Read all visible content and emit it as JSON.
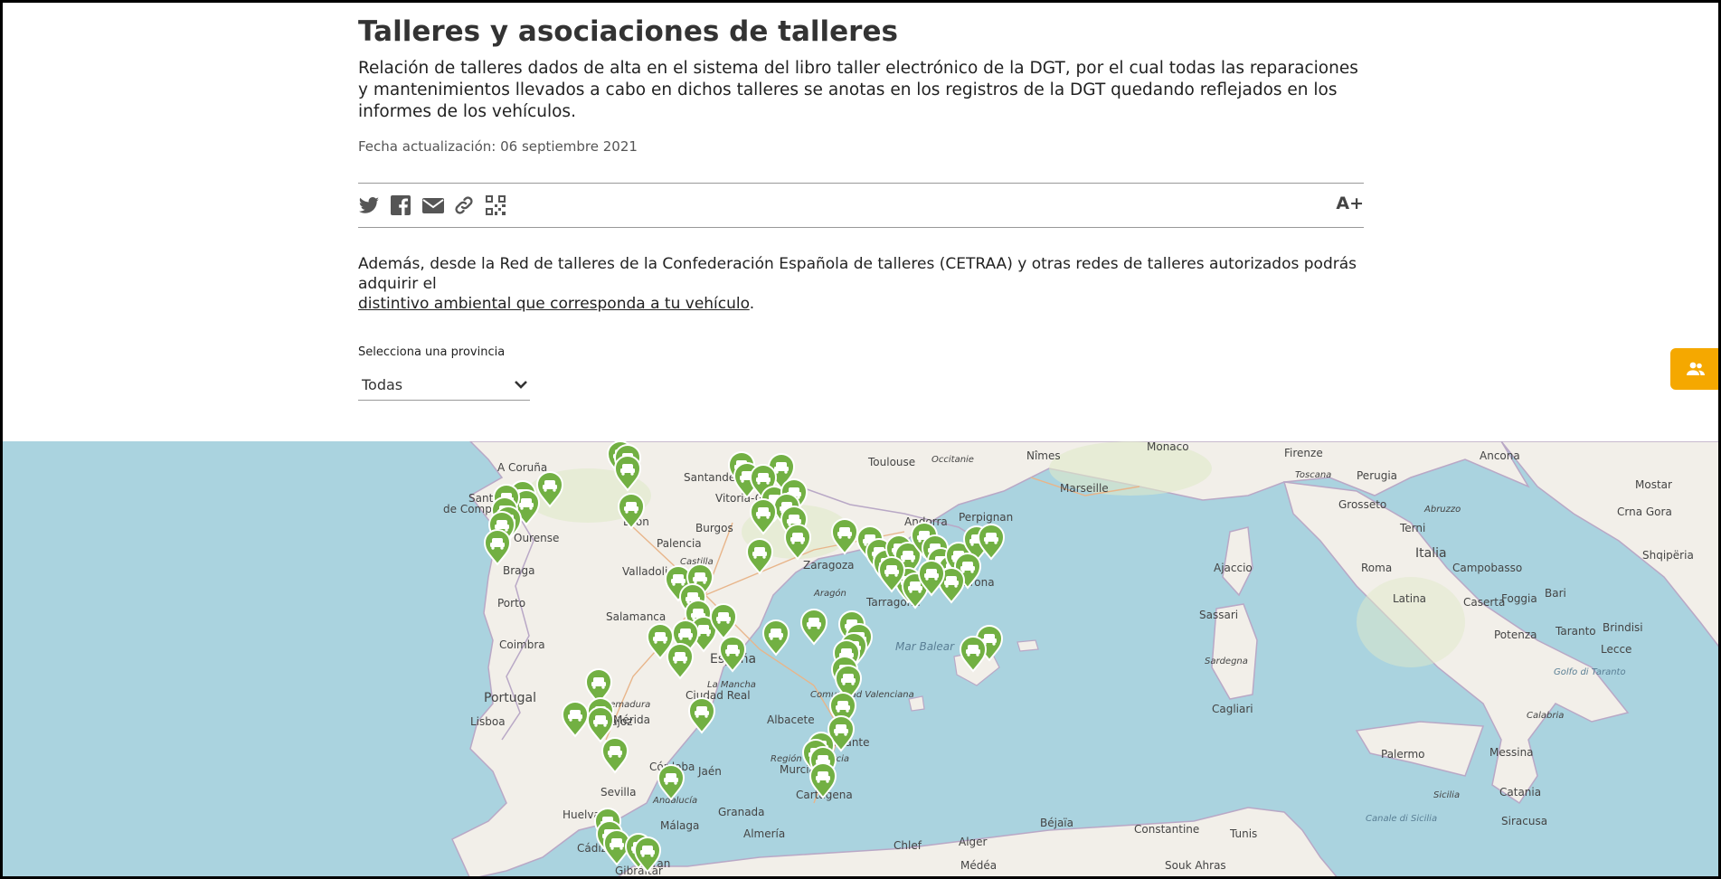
{
  "page": {
    "title": "Talleres y asociaciones de talleres",
    "intro": "Relación de talleres dados de alta en el sistema del libro taller electrónico de la DGT, por el cual todas las reparaciones y mantenimientos llevados a cabo en dichos talleres se anotas en los registros de la DGT quedando reflejados en los informes de los vehículos.",
    "updated": "Fecha actualización: 06 septiembre 2021"
  },
  "share": {
    "icons": [
      "twitter-icon",
      "facebook-icon",
      "email-icon",
      "link-icon",
      "qr-code-icon"
    ],
    "font_size_label": "A+"
  },
  "note": {
    "text_before": "Además, desde la Red de talleres de la Confederación Española de talleres (CETRAA) y otras redes de talleres autorizados podrás adquirir el ",
    "link_text": "distintivo ambiental  que corresponda a tu vehículo",
    "text_after": "."
  },
  "province_select": {
    "label": "Selecciona una provincia",
    "selected": "Todas"
  },
  "map": {
    "colors": {
      "sea": "#aad3df",
      "land": "#f2efe9",
      "marker": "#72b043"
    },
    "cities": [
      "A Coruña",
      "Santiago de Compostela",
      "Ourense",
      "Braga",
      "Porto",
      "Coimbra",
      "Lisboa",
      "Portugal",
      "Santander",
      "Vitoria-Gasteiz",
      "Burgos",
      "Palencia",
      "Valladolid",
      "León",
      "Salamanca",
      "Zaragoza",
      "Aragón",
      "Andorra",
      "Perpignan",
      "Tarragona",
      "Girona",
      "Badajoz",
      "Mérida",
      "Extremadura",
      "Sevilla",
      "Córdoba",
      "Jaén",
      "Huelva",
      "Málaga",
      "Granada",
      "Almería",
      "Cádiz",
      "Gibraltar",
      "Andalucía",
      "Ciudad Real",
      "La Mancha",
      "Albacete",
      "Murcia",
      "Región de Murcia",
      "Cartagena",
      "Alicante",
      "Comunidad Valenciana",
      "España",
      "Castilla y León",
      "Mar Balear",
      "Toulouse",
      "Occitanie",
      "Nîmes",
      "Marseille",
      "Monaco",
      "Firenze",
      "Toscana",
      "Perugia",
      "Grosseto",
      "Terni",
      "Roma",
      "Italia",
      "Abruzzo",
      "Campobasso",
      "Latina",
      "Foggia",
      "Caserta",
      "Bari",
      "Potenza",
      "Taranto",
      "Brindisi",
      "Lecce",
      "Sassari",
      "Sardegna",
      "Cagliari",
      "Ajaccio",
      "Palermo",
      "Messina",
      "Catania",
      "Siracusa",
      "Sicilia",
      "Ancona",
      "Mostar",
      "Crna Gora",
      "Shqipëria",
      "Oran",
      "Alger",
      "Constantine",
      "Tunis",
      "Béjaïa",
      "Chlef",
      "Médéa",
      "Souk Ahras",
      "Canale di Sicilia",
      "Golfo di Taranto",
      "Calabria"
    ]
  }
}
